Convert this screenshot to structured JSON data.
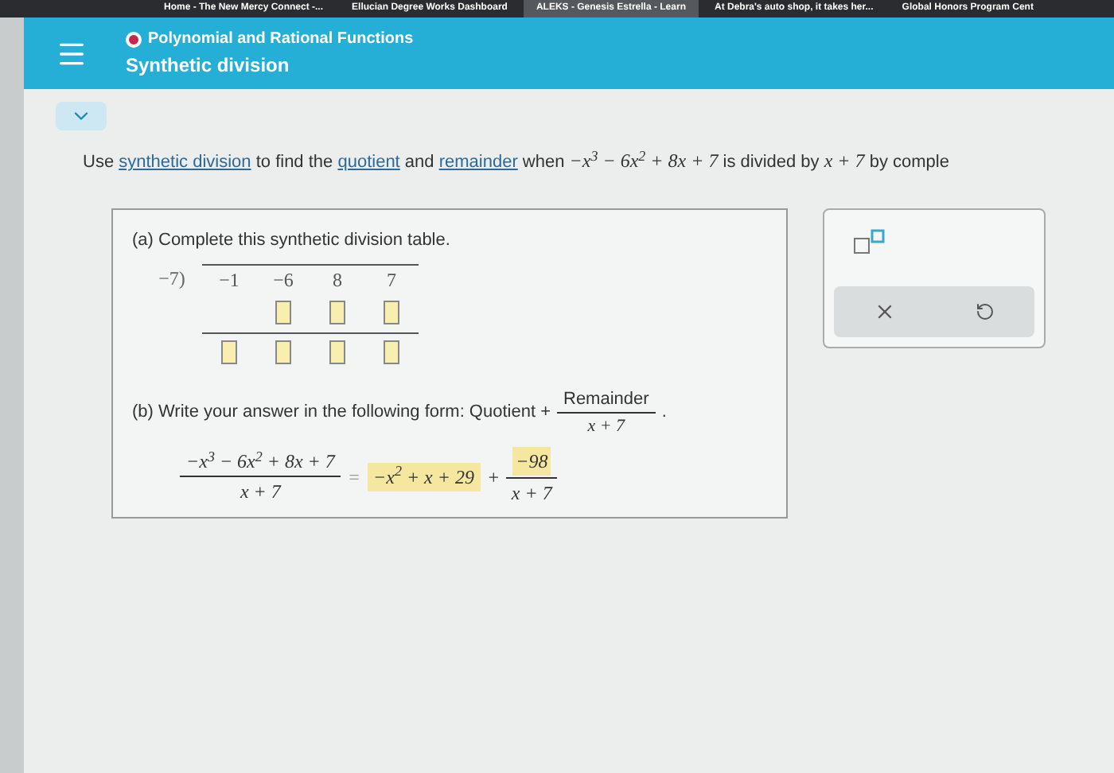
{
  "browser_tabs": [
    {
      "title": "Home - The New Mercy Connect -...",
      "selected": false
    },
    {
      "title": "Ellucian Degree Works Dashboard",
      "selected": false
    },
    {
      "title": "ALEKS - Genesis Estrella - Learn",
      "selected": true
    },
    {
      "title": "At Debra's auto shop, it takes her...",
      "selected": false
    },
    {
      "title": "Global Honors Program Cent",
      "selected": false
    }
  ],
  "header": {
    "topic": "Polynomial and Rational Functions",
    "title": "Synthetic division"
  },
  "question": [
    {
      "kind": "text",
      "text": "Use "
    },
    {
      "kind": "link",
      "text": "synthetic division"
    },
    {
      "kind": "text",
      "text": " to find the "
    },
    {
      "kind": "link",
      "text": "quotient"
    },
    {
      "kind": "text",
      "text": " and "
    },
    {
      "kind": "link",
      "text": "remainder"
    },
    {
      "kind": "text",
      "text": " when "
    },
    {
      "kind": "math",
      "text": "−x$^{3}$ − 6x$^{2}$ + 8x + 7"
    },
    {
      "kind": "text",
      "text": " is divided by "
    },
    {
      "kind": "math",
      "text": "x + 7"
    },
    {
      "kind": "text",
      "text": " by comple"
    }
  ],
  "part_a": {
    "label": "(a) Complete this synthetic division table.",
    "divisor": "−7)",
    "coefficients": [
      "−1",
      "−6",
      "8",
      "7"
    ]
  },
  "part_b": {
    "label": "(b) Write your answer in the following form: Quotient +",
    "form_numerator": "Remainder",
    "form_denominator": "x + 7",
    "form_end": ".",
    "lhs_numerator": "−x$^{3}$ − 6x$^{2}$ + 8x + 7",
    "lhs_denominator": "x + 7",
    "equals": "=",
    "quotient_answer": "−x$^{2}$ + x + 29",
    "plus": "+",
    "remainder_answer": "−98",
    "rhs_denominator": "x + 7"
  }
}
